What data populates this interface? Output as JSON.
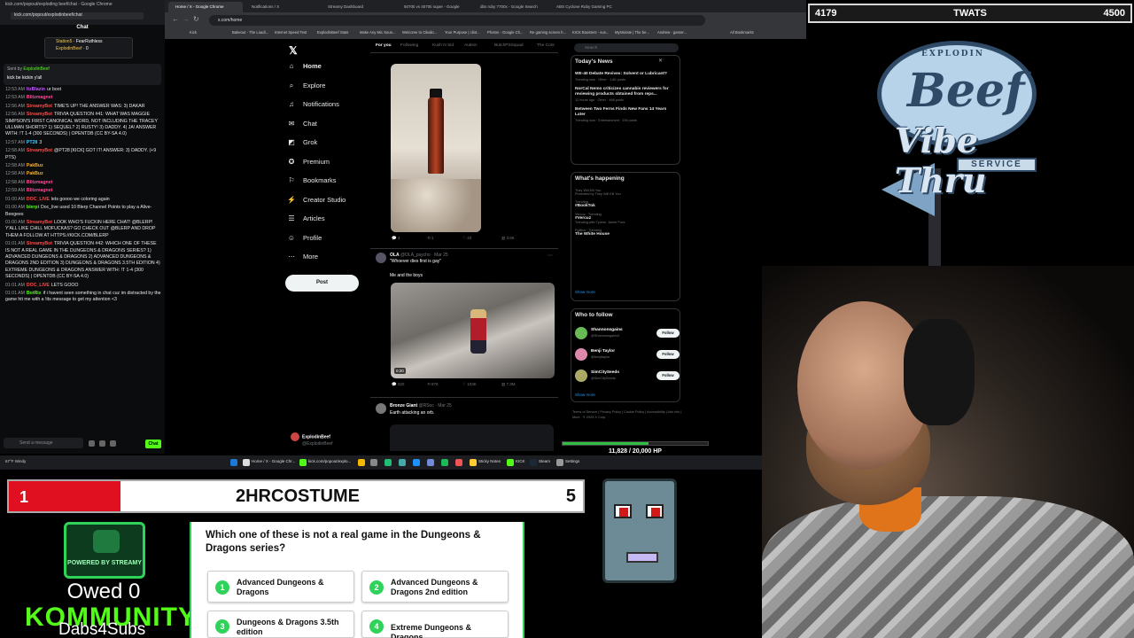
{
  "chat": {
    "url": "kick.com/popout/exploding beef/chat - Google Chrome",
    "url2": "kick.com/popout/explodinbeef/chat",
    "title": "Chat",
    "gifts": [
      {
        "name": "Station5",
        "text": "FearRuthless"
      },
      {
        "name": "ExplodinBeef",
        "text": "0"
      }
    ],
    "pinned_by": "Sent by",
    "pinned_user": "ExplodinBeef",
    "pinned_msg": "kick be kickin y'all",
    "messages": [
      {
        "time": "12:53 AM",
        "user": "ItzBlazin",
        "color": "#c45bff",
        "text": "ur boot"
      },
      {
        "time": "12:53 AM",
        "user": "Blitzmagnet",
        "color": "#ff4a9a",
        "text": ""
      },
      {
        "time": "12:56 AM",
        "user": "StreamyBot",
        "color": "#ff4a4a",
        "text": "TIME'S UP! THE ANSWER WAS: 3) DAKAR"
      },
      {
        "time": "12:56 AM",
        "user": "StreamyBot",
        "color": "#ff4a4a",
        "text": "TRIVIA QUESTION #41: WHAT WAS MAGGIE SIMPSON'S FIRST CANONICAL WORD, NOT INCLUDING THE TRACEY ULLMAN SHORTS? 1) SEQUEL? 2) RUSTY! 3) DADDY. 4) JA! ANSWER WITH: !T 1-4 (300 SECONDS) | OPENTDB (CC BY-SA 4.0)"
      },
      {
        "time": "12:57 AM",
        "user": "PT28",
        "color": "#3ec9ff",
        "text": "3"
      },
      {
        "time": "12:58 AM",
        "user": "StreamyBot",
        "color": "#ff4a4a",
        "text": "@PT28 [KICK] GOT IT! ANSWER: 3) DADDY. (+9 PTS)"
      },
      {
        "time": "12:58 AM",
        "user": "PakBuz",
        "color": "#ffb020",
        "text": ""
      },
      {
        "time": "12:58 AM",
        "user": "PakBuz",
        "color": "#ffb020",
        "text": ""
      },
      {
        "time": "12:58 AM",
        "user": "Blitzmagnet",
        "color": "#ff4a9a",
        "text": ""
      },
      {
        "time": "12:59 AM",
        "user": "Blitzmagnet",
        "color": "#ff4a9a",
        "text": ""
      },
      {
        "time": "01:00 AM",
        "user": "DOC_LIVE",
        "color": "#ff4a4a",
        "text": "lets goooo we coloring again"
      },
      {
        "time": "01:00 AM",
        "user": "blerpi",
        "color": "#53fc18",
        "text": "Doc_live used 10 Blerp Channel Points to play a Alive-Beegees"
      },
      {
        "time": "01:00 AM",
        "user": "StreamyBot",
        "color": "#ff4a4a",
        "text": "LOOK WHO'S FUCKIN HERE CHAT! @BLERP! Y'ALL LIKE CHILL MOFUCKAS? GO CHECK OUT @BLERP AND DROP THEM A FOLLOW AT HTTPS://KICK.COM/BLERP"
      },
      {
        "time": "01:01 AM",
        "user": "StreamyBot",
        "color": "#ff4a4a",
        "text": "TRIVIA QUESTION #42: WHICH ONE OF THESE IS NOT A REAL GAME IN THE DUNGEONS & DRAGONS SERIES? 1) ADVANCED DUNGEONS & DRAGONS 2) ADVANCED DUNGEONS & DRAGONS 2ND EDITION 3) DUNGEONS & DRAGONS 3.5TH EDITION 4) EXTREME DUNGEONS & DRAGONS ANSWER WITH: !T 1-4 (300 SECONDS) | OPENTDB (CC BY-SA 4.0)"
      },
      {
        "time": "01:01 AM",
        "user": "DOC_LIVE",
        "color": "#ff4a4a",
        "text": "LETS GOOO"
      },
      {
        "time": "01:01 AM",
        "user": "BotRix",
        "color": "#53fc18",
        "text": "if i havent seen something in chat cuz im distracted by the game hit me with a !tts message to get my attention <3"
      }
    ],
    "input_placeholder": "Send a message",
    "send_label": "Chat"
  },
  "browser": {
    "tabs": [
      "Home / X - Google Chrome",
      "Notifications / X",
      "Streamy Dashboard",
      "5070ti vs 4070ti super - Google",
      "dbs ruby 7700x - Google Search",
      "ABS Cyclone Ruby Gaming PC"
    ],
    "url": "x.com/home",
    "bookmarks": [
      "Kick",
      "Bakeout - The Loadi...",
      "Internet Speed Test",
      "ExplodinBeef Stats",
      "Make Any Mic Soun...",
      "Welcome to Cikalio...",
      "Your Purpose | clint...",
      "Photon - Google Ch...",
      "Re gaming screen h...",
      "KICK Boosters - vus...",
      "Mystsirate | The be...",
      "Andrew - gamer...",
      "All Bookmarks"
    ],
    "nav": [
      {
        "icon": "⌂",
        "label": "Home",
        "name": "home"
      },
      {
        "icon": "⌕",
        "label": "Explore",
        "name": "explore"
      },
      {
        "icon": "♫",
        "label": "Notifications",
        "name": "notifications"
      },
      {
        "icon": "✉",
        "label": "Chat",
        "name": "chat"
      },
      {
        "icon": "◩",
        "label": "Grok",
        "name": "grok"
      },
      {
        "icon": "✪",
        "label": "Premium",
        "name": "premium"
      },
      {
        "icon": "⚐",
        "label": "Bookmarks",
        "name": "bookmarks"
      },
      {
        "icon": "⚡",
        "label": "Creator Studio",
        "name": "creator-studio"
      },
      {
        "icon": "☰",
        "label": "Articles",
        "name": "articles"
      },
      {
        "icon": "☺",
        "label": "Profile",
        "name": "profile"
      },
      {
        "icon": "⋯",
        "label": "More",
        "name": "more"
      }
    ],
    "post_label": "Post",
    "account_name": "ExplodinBeef",
    "account_handle": "@ExplodinBeef",
    "feed_tabs": [
      "For you",
      "Following",
      "Kush N Sid",
      "Autism",
      "ButchPSSquad",
      "The Cont"
    ],
    "tweet1_stats": [
      "4",
      "1",
      "23",
      "3.6K"
    ],
    "tweet2": {
      "name": "OLA",
      "handle": "@OLA_psycho · Mar 25",
      "text": "\"Whoever dies first is gay\"",
      "sub": "Me and the boys",
      "duration": "0:20",
      "stats": [
        "320",
        "879",
        "103K",
        "7.3M"
      ]
    },
    "tweet3": {
      "name": "Bronze Giant",
      "handle": "@RSoc · Mar 25",
      "text": "Earth attacking an orb."
    },
    "search_placeholder": "Search",
    "news_title": "Today's News",
    "news": [
      {
        "title": "WE-40 Debate Revives: Solvent or Lubricant?",
        "meta": "Trending now · Other · 1.6K posts"
      },
      {
        "title": "NorCal Nemo criticizes cannabis reviewers for reviewing products obtained from reps...",
        "meta": "12 hours ago · Other · 468 posts"
      },
      {
        "title": "Between Two Ferns Finds New Fans 14 Years Later",
        "meta": "Trending now · Entertainment · 106 posts"
      }
    ],
    "happening_title": "What's happening",
    "trends": [
      {
        "cat": "They Will Kill You",
        "name": "",
        "sub": "Promoted by They Will Kill You"
      },
      {
        "cat": "Trending",
        "name": "#BookTok",
        "sub": ""
      },
      {
        "cat": "Vercuz · Trending",
        "name": "#Vercuz",
        "sub": "Trending with Tyrese, Jamie Foxx"
      },
      {
        "cat": "Politics · Trending",
        "name": "The White House",
        "sub": ""
      }
    ],
    "show_more": "Show more",
    "wtf_title": "Who to follow",
    "wtf": [
      {
        "name": "Shannonsgains",
        "handle": "@ShannonsgainsX"
      },
      {
        "name": "Benji Taylor",
        "handle": "@benjitaylor"
      },
      {
        "name": "SimCitySeeds",
        "handle": "@SimCitySeeds"
      }
    ],
    "follow_label": "Follow",
    "footer": "Terms of Service | Privacy Policy | Cookie Policy | Accessibility | Ads info | More · © 2025 X Corp."
  },
  "taskbar": {
    "weather": "67°F Windy",
    "apps": [
      "Home / X - Google Chr...",
      "kick.com/popout/explo..."
    ],
    "pinned": [
      "Sticky Notes",
      "KICK",
      "Steam",
      "Settings"
    ]
  },
  "hp": {
    "text": "11,828 / 20,000 HP",
    "fraction": 0.5914,
    "color": "#2fbf43"
  },
  "goal_bar": {
    "left": "4179",
    "mid": "TWATS",
    "right": "4500"
  },
  "logo": {
    "top": "EXPLODIN",
    "main": "Beef",
    "vibe": "Vibe Thru",
    "service": "SERVICE"
  },
  "trivia": {
    "position": "1",
    "user": "2HRCOSTUME",
    "score": "5",
    "question": "Which one of these is not a real game in the Dungeons & Dragons series?",
    "answers": [
      {
        "num": "1",
        "text": "Advanced Dungeons & Dragons"
      },
      {
        "num": "2",
        "text": "Advanced Dungeons & Dragons 2nd edition"
      },
      {
        "num": "3",
        "text": "Dungeons & Dragons 3.5th edition"
      },
      {
        "num": "4",
        "text": "Extreme Dungeons & Dragons"
      }
    ]
  },
  "streamy": {
    "badge": "POWERED BY STREAMY",
    "owed": "Owed 0",
    "kommunity": "KOMMUNITY",
    "dabs": "Dabs4Subs"
  },
  "colors": {
    "kick_green": "#53fc18",
    "x_blue": "#1d9bf0",
    "trivia_red": "#e01020",
    "hp_green": "#2fbf43"
  }
}
